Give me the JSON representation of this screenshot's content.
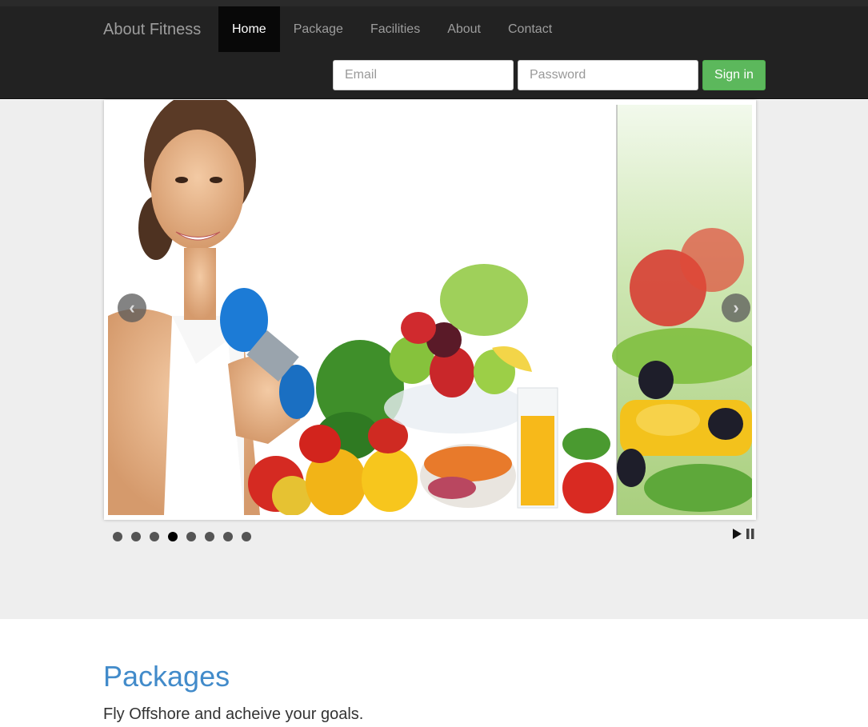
{
  "navbar": {
    "brand": "About Fitness",
    "items": [
      {
        "label": "Home",
        "active": true
      },
      {
        "label": "Package",
        "active": false
      },
      {
        "label": "Facilities",
        "active": false
      },
      {
        "label": "About",
        "active": false
      },
      {
        "label": "Contact",
        "active": false
      }
    ]
  },
  "signin": {
    "email_placeholder": "Email",
    "password_placeholder": "Password",
    "button_label": "Sign in"
  },
  "carousel": {
    "prev_icon": "chevron-left-icon",
    "next_icon": "chevron-right-icon",
    "dot_count": 8,
    "active_dot": 4,
    "play_icon": "play-icon",
    "pause_icon": "pause-icon"
  },
  "packages": {
    "title": "Packages",
    "subtitle": "Fly Offshore and acheive your goals."
  },
  "colors": {
    "navbar_bg": "#222222",
    "active_nav_bg": "#080808",
    "signin_green": "#5cb85c",
    "heading_blue": "#428bca",
    "hero_bg": "#eeeeee"
  }
}
